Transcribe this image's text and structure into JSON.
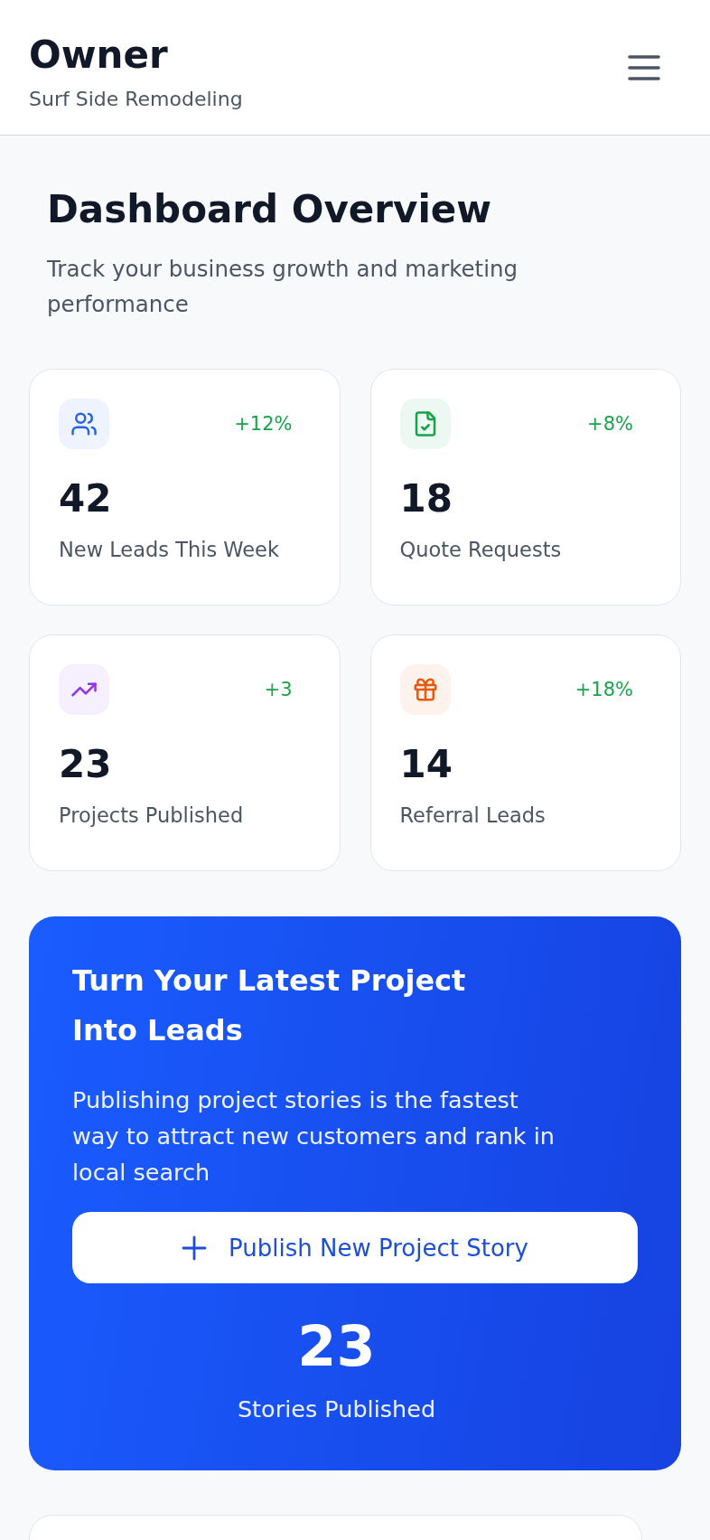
{
  "header": {
    "title": "Owner",
    "subtitle": "Surf Side Remodeling"
  },
  "overview": {
    "title": "Dashboard Overview",
    "subtitle": "Track your business growth and marketing performance"
  },
  "stats": [
    {
      "kind": "users",
      "color": "#2563eb",
      "change": "+12%",
      "value": "42",
      "label": "New Leads This Week"
    },
    {
      "kind": "document",
      "color": "#16a34a",
      "change": "+8%",
      "value": "18",
      "label": "Quote Requests"
    },
    {
      "kind": "trend",
      "color": "#9333ea",
      "change": "+3",
      "value": "23",
      "label": "Projects Published"
    },
    {
      "kind": "gift",
      "color": "#ea580c",
      "change": "+18%",
      "value": "14",
      "label": "Referral Leads"
    }
  ],
  "promo": {
    "title": "Turn Your Latest Project Into Leads",
    "text": "Publishing project stories is the fastest way to attract new customers and rank in local search",
    "button": "Publish New Project Story",
    "count": "23",
    "count_label": "Stories Published"
  }
}
